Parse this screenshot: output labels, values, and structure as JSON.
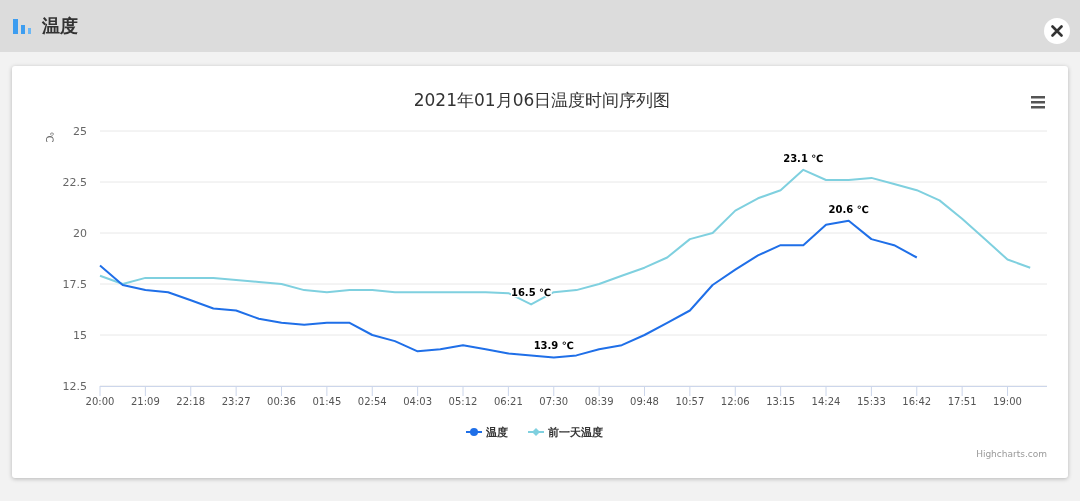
{
  "header": {
    "title": "温度"
  },
  "chart": {
    "chart_data": {
      "type": "line",
      "title": "2021年01月06日温度时间序列图",
      "ylabel": "℃",
      "categories": [
        "20:00",
        null,
        "21:09",
        null,
        "22:18",
        null,
        "23:27",
        null,
        "00:36",
        null,
        "01:45",
        null,
        "02:54",
        null,
        "04:03",
        null,
        "05:12",
        null,
        "06:21",
        null,
        "07:30",
        null,
        "08:39",
        null,
        "09:48",
        null,
        "10:57",
        null,
        "12:06",
        null,
        "13:15",
        null,
        "14:24",
        null,
        "15:33",
        null,
        "16:42",
        null,
        "17:51",
        null,
        "19:00",
        null
      ],
      "series": [
        {
          "name": "温度",
          "color": "#1f6fe8",
          "values": [
            18.4,
            17.45,
            17.2,
            17.1,
            16.7,
            16.3,
            16.2,
            15.8,
            15.6,
            15.5,
            15.6,
            15.6,
            15.0,
            14.7,
            14.2,
            14.3,
            14.5,
            14.3,
            14.1,
            14.0,
            13.9,
            14.0,
            14.3,
            14.5,
            15.0,
            15.6,
            16.2,
            17.45,
            18.2,
            18.9,
            19.4,
            19.4,
            20.4,
            20.6,
            19.7,
            19.4,
            18.8,
            null,
            null,
            null,
            null,
            null
          ]
        },
        {
          "name": "前一天温度",
          "color": "#7fd0df",
          "values": [
            17.9,
            17.5,
            17.8,
            17.8,
            17.8,
            17.8,
            17.7,
            17.6,
            17.5,
            17.2,
            17.1,
            17.2,
            17.2,
            17.1,
            17.1,
            17.1,
            17.1,
            17.1,
            17.05,
            16.5,
            17.1,
            17.2,
            17.5,
            17.9,
            18.3,
            18.8,
            19.7,
            20.0,
            21.1,
            21.7,
            22.1,
            23.1,
            22.6,
            22.6,
            22.7,
            22.4,
            22.1,
            21.6,
            20.7,
            19.7,
            18.7,
            18.3
          ]
        }
      ],
      "ylim": [
        12.5,
        25
      ],
      "yticks": [
        {
          "value": 12.5,
          "label": "12.5"
        },
        {
          "value": 15,
          "label": "15"
        },
        {
          "value": 17.5,
          "label": "17.5"
        },
        {
          "value": 20,
          "label": "20"
        },
        {
          "value": 22.5,
          "label": "22.5"
        },
        {
          "value": 25,
          "label": "25"
        }
      ],
      "grid": true,
      "legend": true,
      "annotations": [
        {
          "y": 23.1,
          "text": "23.1 ℃"
        },
        {
          "y": 20.6,
          "text": "20.6 ℃"
        },
        {
          "y": 16.5,
          "text": "16.5 ℃"
        },
        {
          "y": 13.9,
          "text": "13.9 ℃"
        }
      ]
    },
    "credits": "Highcharts.com"
  }
}
